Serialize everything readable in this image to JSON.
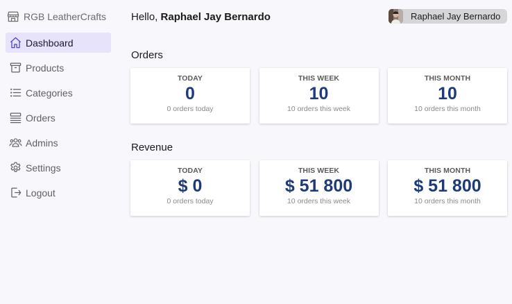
{
  "app": {
    "name": "RGB LeatherCrafts"
  },
  "sidebar": {
    "items": [
      {
        "label": "Dashboard",
        "icon": "home-icon",
        "active": true
      },
      {
        "label": "Products",
        "icon": "archive-box-icon"
      },
      {
        "label": "Categories",
        "icon": "list-icon"
      },
      {
        "label": "Orders",
        "icon": "queue-list-icon"
      },
      {
        "label": "Admins",
        "icon": "users-icon"
      },
      {
        "label": "Settings",
        "icon": "gear-icon"
      },
      {
        "label": "Logout",
        "icon": "logout-icon"
      }
    ]
  },
  "header": {
    "greeting_prefix": "Hello,",
    "user_name": "Raphael Jay Bernardo",
    "chip_name": "Raphael Jay Bernardo"
  },
  "orders": {
    "title": "Orders",
    "cards": [
      {
        "label": "TODAY",
        "value": "0",
        "sub": "0 orders today"
      },
      {
        "label": "THIS WEEK",
        "value": "10",
        "sub": "10 orders this week"
      },
      {
        "label": "THIS MONTH",
        "value": "10",
        "sub": "10 orders this month"
      }
    ]
  },
  "revenue": {
    "title": "Revenue",
    "cards": [
      {
        "label": "TODAY",
        "value": "$ 0",
        "sub": "0 orders today"
      },
      {
        "label": "THIS WEEK",
        "value": "$ 51 800",
        "sub": "10 orders this week"
      },
      {
        "label": "THIS MONTH",
        "value": "$ 51 800",
        "sub": "10 orders this month"
      }
    ]
  },
  "colors": {
    "accent": "#4b3fd4",
    "active_bg": "#e6e3fb",
    "value": "#1d3a7d",
    "background": "#f8f8fc"
  }
}
